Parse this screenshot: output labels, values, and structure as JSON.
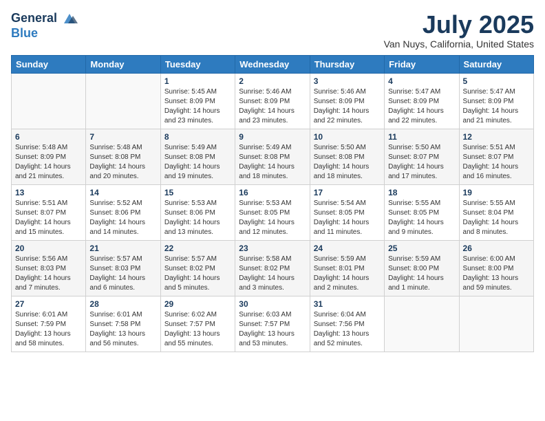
{
  "header": {
    "logo_general": "General",
    "logo_blue": "Blue",
    "title": "July 2025",
    "subtitle": "Van Nuys, California, United States"
  },
  "weekdays": [
    "Sunday",
    "Monday",
    "Tuesday",
    "Wednesday",
    "Thursday",
    "Friday",
    "Saturday"
  ],
  "weeks": [
    [
      {
        "day": "",
        "info": ""
      },
      {
        "day": "",
        "info": ""
      },
      {
        "day": "1",
        "info": "Sunrise: 5:45 AM\nSunset: 8:09 PM\nDaylight: 14 hours\nand 23 minutes."
      },
      {
        "day": "2",
        "info": "Sunrise: 5:46 AM\nSunset: 8:09 PM\nDaylight: 14 hours\nand 23 minutes."
      },
      {
        "day": "3",
        "info": "Sunrise: 5:46 AM\nSunset: 8:09 PM\nDaylight: 14 hours\nand 22 minutes."
      },
      {
        "day": "4",
        "info": "Sunrise: 5:47 AM\nSunset: 8:09 PM\nDaylight: 14 hours\nand 22 minutes."
      },
      {
        "day": "5",
        "info": "Sunrise: 5:47 AM\nSunset: 8:09 PM\nDaylight: 14 hours\nand 21 minutes."
      }
    ],
    [
      {
        "day": "6",
        "info": "Sunrise: 5:48 AM\nSunset: 8:09 PM\nDaylight: 14 hours\nand 21 minutes."
      },
      {
        "day": "7",
        "info": "Sunrise: 5:48 AM\nSunset: 8:08 PM\nDaylight: 14 hours\nand 20 minutes."
      },
      {
        "day": "8",
        "info": "Sunrise: 5:49 AM\nSunset: 8:08 PM\nDaylight: 14 hours\nand 19 minutes."
      },
      {
        "day": "9",
        "info": "Sunrise: 5:49 AM\nSunset: 8:08 PM\nDaylight: 14 hours\nand 18 minutes."
      },
      {
        "day": "10",
        "info": "Sunrise: 5:50 AM\nSunset: 8:08 PM\nDaylight: 14 hours\nand 18 minutes."
      },
      {
        "day": "11",
        "info": "Sunrise: 5:50 AM\nSunset: 8:07 PM\nDaylight: 14 hours\nand 17 minutes."
      },
      {
        "day": "12",
        "info": "Sunrise: 5:51 AM\nSunset: 8:07 PM\nDaylight: 14 hours\nand 16 minutes."
      }
    ],
    [
      {
        "day": "13",
        "info": "Sunrise: 5:51 AM\nSunset: 8:07 PM\nDaylight: 14 hours\nand 15 minutes."
      },
      {
        "day": "14",
        "info": "Sunrise: 5:52 AM\nSunset: 8:06 PM\nDaylight: 14 hours\nand 14 minutes."
      },
      {
        "day": "15",
        "info": "Sunrise: 5:53 AM\nSunset: 8:06 PM\nDaylight: 14 hours\nand 13 minutes."
      },
      {
        "day": "16",
        "info": "Sunrise: 5:53 AM\nSunset: 8:05 PM\nDaylight: 14 hours\nand 12 minutes."
      },
      {
        "day": "17",
        "info": "Sunrise: 5:54 AM\nSunset: 8:05 PM\nDaylight: 14 hours\nand 11 minutes."
      },
      {
        "day": "18",
        "info": "Sunrise: 5:55 AM\nSunset: 8:05 PM\nDaylight: 14 hours\nand 9 minutes."
      },
      {
        "day": "19",
        "info": "Sunrise: 5:55 AM\nSunset: 8:04 PM\nDaylight: 14 hours\nand 8 minutes."
      }
    ],
    [
      {
        "day": "20",
        "info": "Sunrise: 5:56 AM\nSunset: 8:03 PM\nDaylight: 14 hours\nand 7 minutes."
      },
      {
        "day": "21",
        "info": "Sunrise: 5:57 AM\nSunset: 8:03 PM\nDaylight: 14 hours\nand 6 minutes."
      },
      {
        "day": "22",
        "info": "Sunrise: 5:57 AM\nSunset: 8:02 PM\nDaylight: 14 hours\nand 5 minutes."
      },
      {
        "day": "23",
        "info": "Sunrise: 5:58 AM\nSunset: 8:02 PM\nDaylight: 14 hours\nand 3 minutes."
      },
      {
        "day": "24",
        "info": "Sunrise: 5:59 AM\nSunset: 8:01 PM\nDaylight: 14 hours\nand 2 minutes."
      },
      {
        "day": "25",
        "info": "Sunrise: 5:59 AM\nSunset: 8:00 PM\nDaylight: 14 hours\nand 1 minute."
      },
      {
        "day": "26",
        "info": "Sunrise: 6:00 AM\nSunset: 8:00 PM\nDaylight: 13 hours\nand 59 minutes."
      }
    ],
    [
      {
        "day": "27",
        "info": "Sunrise: 6:01 AM\nSunset: 7:59 PM\nDaylight: 13 hours\nand 58 minutes."
      },
      {
        "day": "28",
        "info": "Sunrise: 6:01 AM\nSunset: 7:58 PM\nDaylight: 13 hours\nand 56 minutes."
      },
      {
        "day": "29",
        "info": "Sunrise: 6:02 AM\nSunset: 7:57 PM\nDaylight: 13 hours\nand 55 minutes."
      },
      {
        "day": "30",
        "info": "Sunrise: 6:03 AM\nSunset: 7:57 PM\nDaylight: 13 hours\nand 53 minutes."
      },
      {
        "day": "31",
        "info": "Sunrise: 6:04 AM\nSunset: 7:56 PM\nDaylight: 13 hours\nand 52 minutes."
      },
      {
        "day": "",
        "info": ""
      },
      {
        "day": "",
        "info": ""
      }
    ]
  ]
}
